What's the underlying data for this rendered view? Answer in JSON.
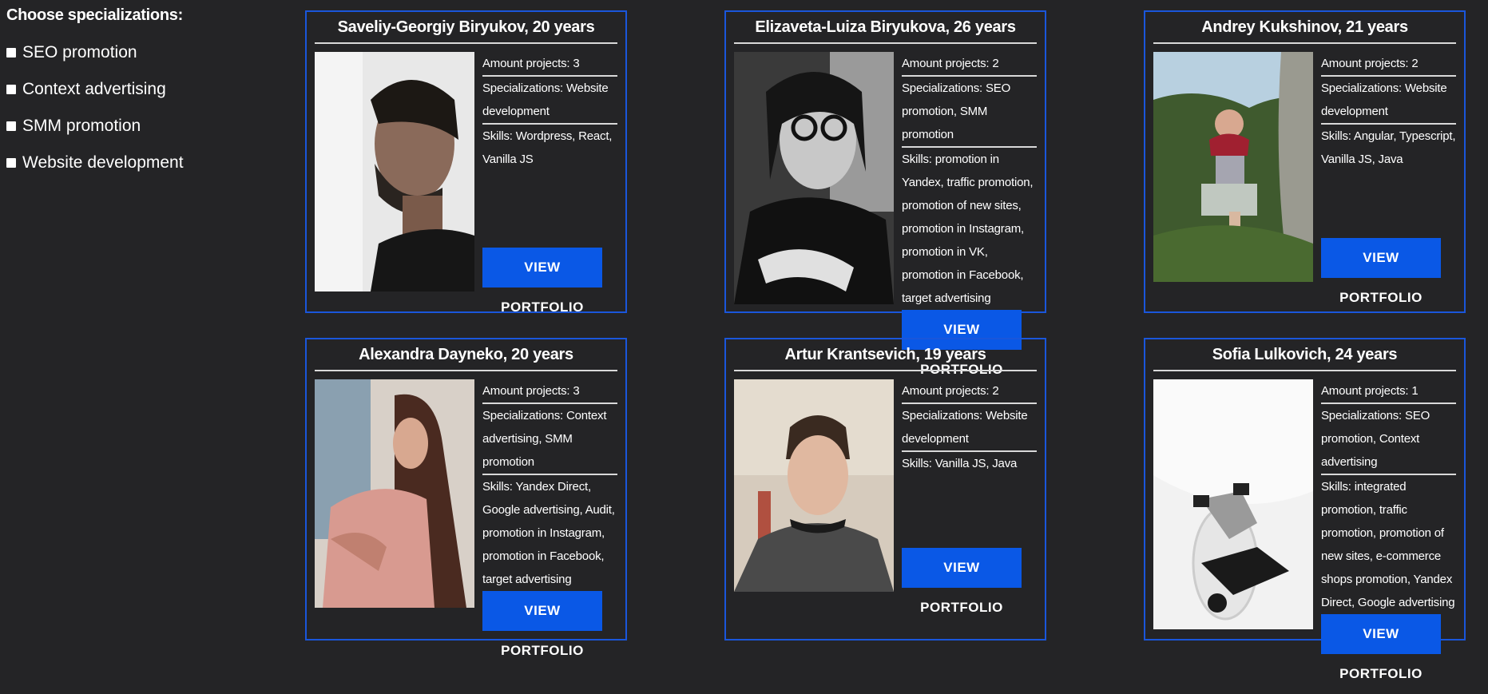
{
  "filters": {
    "title": "Choose specializations:",
    "options": [
      {
        "label": "SEO promotion"
      },
      {
        "label": "Context advertising"
      },
      {
        "label": "SMM promotion"
      },
      {
        "label": "Website development"
      }
    ]
  },
  "colors": {
    "background": "#242426",
    "card_border": "#1a56db",
    "button": "#0a58e6",
    "divider": "#d9d9d9"
  },
  "cards": [
    {
      "name": "Saveliy-Georgiy Biryukov, 20 years",
      "projects": "Amount projects: 3",
      "specializations": "Specializations: Website development",
      "skills": "Skills: Wordpress, React, Vanilla JS",
      "button": "VIEW PORTFOLIO"
    },
    {
      "name": "Elizaveta-Luiza Biryukova, 26 years",
      "projects": "Amount projects: 2",
      "specializations": "Specializations: SEO promotion, SMM promotion",
      "skills": "Skills: promotion in Yandex, traffic promotion, promotion of new sites, promotion in Instagram, promotion in VK, promotion in Facebook, target advertising",
      "button": "VIEW PORTFOLIO"
    },
    {
      "name": "Andrey Kukshinov, 21 years",
      "projects": "Amount projects: 2",
      "specializations": "Specializations: Website development",
      "skills": "Skills: Angular, Typescript, Vanilla JS, Java",
      "button": "VIEW PORTFOLIO"
    },
    {
      "name": "Alexandra Dayneko, 20 years",
      "projects": "Amount projects: 3",
      "specializations": "Specializations: Context advertising, SMM promotion",
      "skills": "Skills: Yandex Direct, Google advertising, Audit, promotion in Instagram, promotion in Facebook, target advertising",
      "button": "VIEW PORTFOLIO"
    },
    {
      "name": "Artur Krantsevich, 19 years",
      "projects": "Amount projects: 2",
      "specializations": "Specializations: Website development",
      "skills": "Skills: Vanilla JS, Java",
      "button": "VIEW PORTFOLIO"
    },
    {
      "name": "Sofia Lulkovich, 24 years",
      "projects": "Amount projects: 1",
      "specializations": "Specializations: SEO promotion, Context advertising",
      "skills": "Skills: integrated promotion, traffic promotion, promotion of new sites, e-commerce shops promotion, Yandex Direct, Google advertising",
      "button": "VIEW PORTFOLIO"
    }
  ]
}
